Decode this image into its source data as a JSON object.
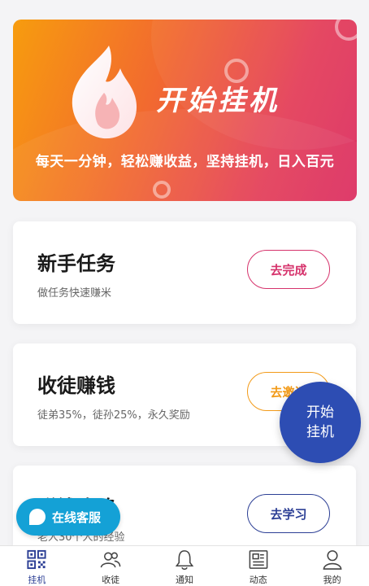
{
  "banner": {
    "title": "开始挂机",
    "subtitle": "每天一分钟，轻松赚收益，坚持挂机，日入百元"
  },
  "cards": [
    {
      "title": "新手任务",
      "desc": "做任务快速赚米",
      "button": "去完成",
      "color": "#d6336c"
    },
    {
      "title": "收徒赚钱",
      "desc": "徒弟35%，徒孙25%，永久奖励",
      "button": "去邀请",
      "color": "#f29a18"
    },
    {
      "title": "赚钱攻略",
      "desc": "老人30个人的经验",
      "button": "去学习",
      "color": "#2c3f95"
    }
  ],
  "fab": {
    "line1": "开始",
    "line2": "挂机"
  },
  "service": {
    "label": "在线客服"
  },
  "tabs": [
    {
      "label": "挂机",
      "icon": "qr-code-icon",
      "active": true
    },
    {
      "label": "收徒",
      "icon": "people-icon",
      "active": false
    },
    {
      "label": "通知",
      "icon": "bell-icon",
      "active": false
    },
    {
      "label": "动态",
      "icon": "newspaper-icon",
      "active": false
    },
    {
      "label": "我的",
      "icon": "person-icon",
      "active": false
    }
  ],
  "colors": {
    "accent": "#2c3f95",
    "fab": "#2d4db3",
    "service": "#14a1d6"
  }
}
